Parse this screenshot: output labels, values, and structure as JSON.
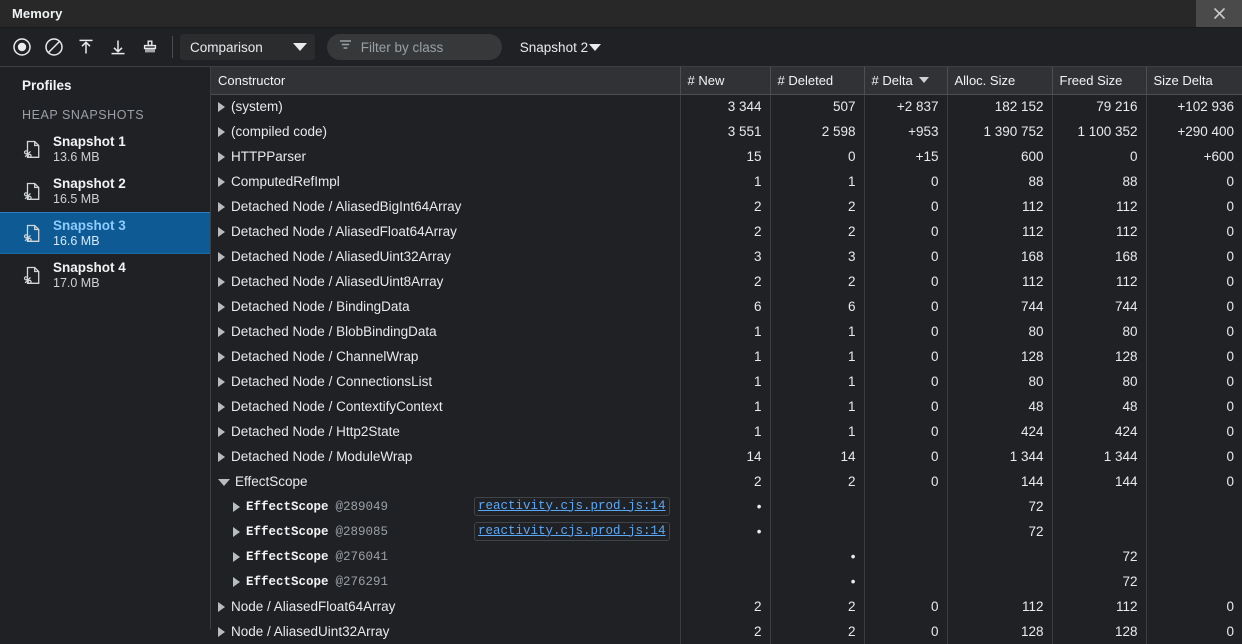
{
  "window": {
    "title": "Memory",
    "close_icon": "close-icon"
  },
  "toolbar": {
    "icons": [
      {
        "name": "record-icon",
        "title": "Record"
      },
      {
        "name": "clear-icon",
        "title": "Clear"
      },
      {
        "name": "load-profile-icon",
        "title": "Load profile"
      },
      {
        "name": "save-profile-icon",
        "title": "Save profile"
      },
      {
        "name": "collect-garbage-icon",
        "title": "Collect garbage"
      }
    ],
    "view_select": {
      "value": "Comparison",
      "caret_icon": "chevron-down-icon"
    },
    "filter": {
      "icon": "filter-icon",
      "placeholder": "Filter by class",
      "value": ""
    },
    "snapshot_select": {
      "value": "Snapshot 2",
      "caret_icon": "chevron-down-icon"
    }
  },
  "sidebar": {
    "title": "Profiles",
    "section_label": "HEAP SNAPSHOTS",
    "snapshots": [
      {
        "name": "Snapshot 1",
        "size": "13.6 MB",
        "selected": false
      },
      {
        "name": "Snapshot 2",
        "size": "16.5 MB",
        "selected": false
      },
      {
        "name": "Snapshot 3",
        "size": "16.6 MB",
        "selected": true
      },
      {
        "name": "Snapshot 4",
        "size": "17.0 MB",
        "selected": false
      }
    ],
    "snapshot_icon": "heap-snapshot-icon"
  },
  "grid": {
    "columns": [
      {
        "label": "Constructor",
        "sorted": false
      },
      {
        "label": "# New",
        "sorted": false
      },
      {
        "label": "# Deleted",
        "sorted": false
      },
      {
        "label": "# Delta",
        "sorted": true,
        "sort_icon": "sort-desc-icon"
      },
      {
        "label": "Alloc. Size",
        "sorted": false
      },
      {
        "label": "Freed Size",
        "sorted": false
      },
      {
        "label": "Size Delta",
        "sorted": false
      }
    ],
    "rows": [
      {
        "level": 0,
        "expanded": false,
        "constructor": "(system)",
        "new": "3 344",
        "deleted": "507",
        "delta": "+2 837",
        "alloc": "182 152",
        "freed": "79 216",
        "size_delta": "+102 936"
      },
      {
        "level": 0,
        "expanded": false,
        "constructor": "(compiled code)",
        "new": "3 551",
        "deleted": "2 598",
        "delta": "+953",
        "alloc": "1 390 752",
        "freed": "1 100 352",
        "size_delta": "+290 400"
      },
      {
        "level": 0,
        "expanded": false,
        "constructor": "HTTPParser",
        "new": "15",
        "deleted": "0",
        "delta": "+15",
        "alloc": "600",
        "freed": "0",
        "size_delta": "+600"
      },
      {
        "level": 0,
        "expanded": false,
        "constructor": "ComputedRefImpl",
        "new": "1",
        "deleted": "1",
        "delta": "0",
        "alloc": "88",
        "freed": "88",
        "size_delta": "0"
      },
      {
        "level": 0,
        "expanded": false,
        "constructor": "Detached Node / AliasedBigInt64Array",
        "new": "2",
        "deleted": "2",
        "delta": "0",
        "alloc": "112",
        "freed": "112",
        "size_delta": "0"
      },
      {
        "level": 0,
        "expanded": false,
        "constructor": "Detached Node / AliasedFloat64Array",
        "new": "2",
        "deleted": "2",
        "delta": "0",
        "alloc": "112",
        "freed": "112",
        "size_delta": "0"
      },
      {
        "level": 0,
        "expanded": false,
        "constructor": "Detached Node / AliasedUint32Array",
        "new": "3",
        "deleted": "3",
        "delta": "0",
        "alloc": "168",
        "freed": "168",
        "size_delta": "0"
      },
      {
        "level": 0,
        "expanded": false,
        "constructor": "Detached Node / AliasedUint8Array",
        "new": "2",
        "deleted": "2",
        "delta": "0",
        "alloc": "112",
        "freed": "112",
        "size_delta": "0"
      },
      {
        "level": 0,
        "expanded": false,
        "constructor": "Detached Node / BindingData",
        "new": "6",
        "deleted": "6",
        "delta": "0",
        "alloc": "744",
        "freed": "744",
        "size_delta": "0"
      },
      {
        "level": 0,
        "expanded": false,
        "constructor": "Detached Node / BlobBindingData",
        "new": "1",
        "deleted": "1",
        "delta": "0",
        "alloc": "80",
        "freed": "80",
        "size_delta": "0"
      },
      {
        "level": 0,
        "expanded": false,
        "constructor": "Detached Node / ChannelWrap",
        "new": "1",
        "deleted": "1",
        "delta": "0",
        "alloc": "128",
        "freed": "128",
        "size_delta": "0"
      },
      {
        "level": 0,
        "expanded": false,
        "constructor": "Detached Node / ConnectionsList",
        "new": "1",
        "deleted": "1",
        "delta": "0",
        "alloc": "80",
        "freed": "80",
        "size_delta": "0"
      },
      {
        "level": 0,
        "expanded": false,
        "constructor": "Detached Node / ContextifyContext",
        "new": "1",
        "deleted": "1",
        "delta": "0",
        "alloc": "48",
        "freed": "48",
        "size_delta": "0"
      },
      {
        "level": 0,
        "expanded": false,
        "constructor": "Detached Node / Http2State",
        "new": "1",
        "deleted": "1",
        "delta": "0",
        "alloc": "424",
        "freed": "424",
        "size_delta": "0"
      },
      {
        "level": 0,
        "expanded": false,
        "constructor": "Detached Node / ModuleWrap",
        "new": "14",
        "deleted": "14",
        "delta": "0",
        "alloc": "1 344",
        "freed": "1 344",
        "size_delta": "0"
      },
      {
        "level": 0,
        "expanded": true,
        "constructor": "EffectScope",
        "new": "2",
        "deleted": "2",
        "delta": "0",
        "alloc": "144",
        "freed": "144",
        "size_delta": "0"
      },
      {
        "level": 1,
        "expanded": false,
        "constructor": "EffectScope",
        "object_id": "@289049",
        "source_link": "reactivity.cjs.prod.js:14",
        "new": "•",
        "deleted": "",
        "delta": "",
        "alloc": "72",
        "freed": "",
        "size_delta": ""
      },
      {
        "level": 1,
        "expanded": false,
        "constructor": "EffectScope",
        "object_id": "@289085",
        "source_link": "reactivity.cjs.prod.js:14",
        "new": "•",
        "deleted": "",
        "delta": "",
        "alloc": "72",
        "freed": "",
        "size_delta": ""
      },
      {
        "level": 1,
        "expanded": false,
        "constructor": "EffectScope",
        "object_id": "@276041",
        "source_link": "",
        "new": "",
        "deleted": "•",
        "delta": "",
        "alloc": "",
        "freed": "72",
        "size_delta": ""
      },
      {
        "level": 1,
        "expanded": false,
        "constructor": "EffectScope",
        "object_id": "@276291",
        "source_link": "",
        "new": "",
        "deleted": "•",
        "delta": "",
        "alloc": "",
        "freed": "72",
        "size_delta": ""
      },
      {
        "level": 0,
        "expanded": false,
        "constructor": "Node / AliasedFloat64Array",
        "new": "2",
        "deleted": "2",
        "delta": "0",
        "alloc": "112",
        "freed": "112",
        "size_delta": "0"
      },
      {
        "level": 0,
        "expanded": false,
        "constructor": "Node / AliasedUint32Array",
        "new": "2",
        "deleted": "2",
        "delta": "0",
        "alloc": "128",
        "freed": "128",
        "size_delta": "0"
      }
    ]
  }
}
